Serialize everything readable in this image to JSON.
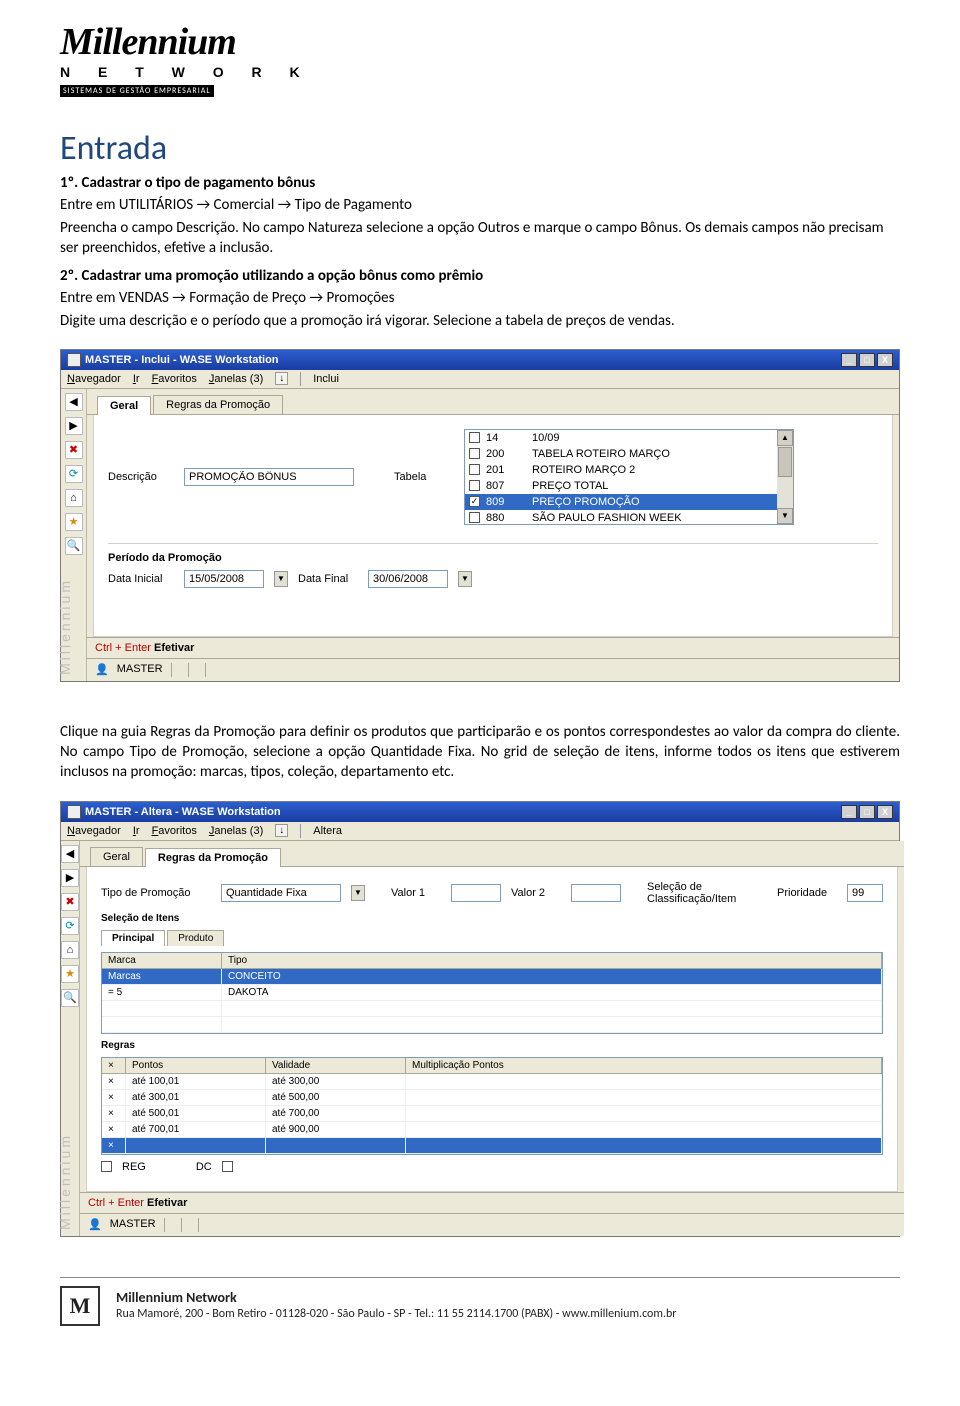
{
  "logo": {
    "brand": "Millennium",
    "network": "N E T W O R K",
    "tag": "SISTEMAS DE GESTÃO EMPRESARIAL"
  },
  "doc": {
    "title": "Entrada",
    "step1_head": "1º. Cadastrar o tipo de pagamento bônus",
    "step1_l1": "Entre em UTILITÁRIOS → Comercial → Tipo de Pagamento",
    "step1_l2": "Preencha o campo Descrição. No campo Natureza selecione a opção Outros e marque o campo Bônus. Os demais campos não precisam ser preenchidos, efetive a inclusão.",
    "step2_head": "2º. Cadastrar uma promoção utilizando a opção bônus como prêmio",
    "step2_l1": "Entre em VENDAS → Formação de Preço → Promoções",
    "step2_l2": "Digite uma descrição e o período que a promoção irá vigorar. Selecione a tabela de preços de vendas.",
    "after_p1": "Clique na guia Regras da Promoção para definir os produtos que participarão e os pontos correspondestes ao valor da compra do cliente. No campo Tipo de Promoção, selecione a opção Quantidade Fixa. No grid de seleção de itens, informe todos os itens que estiverem inclusos na promoção: marcas, tipos, coleção, departamento etc."
  },
  "win1": {
    "title": "MASTER - Inclui - WASE Workstation",
    "menu": {
      "nav": "Navegador",
      "ir": "Ir",
      "fav": "Favoritos",
      "jan": "Janelas (3)",
      "crumb": "Inclui"
    },
    "tabs": {
      "geral": "Geral",
      "regras": "Regras da Promoção"
    },
    "labels": {
      "descricao": "Descrição",
      "tabela": "Tabela",
      "periodo": "Período da Promoção",
      "data_inicial": "Data Inicial",
      "data_final": "Data Final"
    },
    "values": {
      "descricao": "PROMOÇÃO BÔNUS",
      "data_inicial": "15/05/2008",
      "data_final": "30/06/2008"
    },
    "tabela_rows": [
      {
        "checked": false,
        "code": "14",
        "desc": "10/09"
      },
      {
        "checked": false,
        "code": "200",
        "desc": "TABELA ROTEIRO MARÇO"
      },
      {
        "checked": false,
        "code": "201",
        "desc": "ROTEIRO MARÇO 2"
      },
      {
        "checked": false,
        "code": "807",
        "desc": "PREÇO TOTAL"
      },
      {
        "checked": true,
        "code": "809",
        "desc": "PREÇO PROMOÇÃO"
      },
      {
        "checked": false,
        "code": "880",
        "desc": "SÃO PAULO FASHION WEEK"
      }
    ],
    "status": {
      "efetivar": "Ctrl + Enter Efetivar",
      "user": "MASTER"
    }
  },
  "win2": {
    "title": "MASTER - Altera - WASE Workstation",
    "menu": {
      "nav": "Navegador",
      "ir": "Ir",
      "fav": "Favoritos",
      "jan": "Janelas (3)",
      "crumb": "Altera"
    },
    "tabs": {
      "geral": "Geral",
      "regras": "Regras da Promoção"
    },
    "labels": {
      "tipo": "Tipo de Promoção",
      "tipo_val": "Quantidade Fixa",
      "valor1": "Valor 1",
      "valor2": "Valor 2",
      "sel0": "Seleção de Classificação/Item",
      "prioridade": "Prioridade",
      "prioridade_val": "99",
      "selitens": "Seleção de Itens",
      "subtab1": "Principal",
      "subtab2": "Produto",
      "col_marca": "Marca",
      "col_tipo": "Tipo",
      "regras_head": "Regras",
      "regra_col1": "Pontos",
      "regra_col2": "Validade",
      "regra_col3": "Multiplicação Pontos",
      "check_label": "DC",
      "regbox": "REG"
    },
    "marca_rows": [
      {
        "c1": "Marcas",
        "c2": "CONCEITO"
      },
      {
        "c1": "= 5",
        "c2": "DAKOTA"
      }
    ],
    "regras_rows": [
      {
        "c1": "até 100,01",
        "c2": "até 300,00"
      },
      {
        "c1": "até 300,01",
        "c2": "até 500,00"
      },
      {
        "c1": "até 500,01",
        "c2": "até 700,00"
      },
      {
        "c1": "até 700,01",
        "c2": "até 900,00"
      }
    ],
    "status": {
      "efetivar": "Ctrl + Enter Efetivar",
      "user": "MASTER"
    }
  },
  "footer": {
    "brand": "Millennium Network",
    "addr": "Rua Mamoré, 200 - Bom Retiro - 01128-020 - São Paulo - SP - Tel.: 11 55 2114.1700 (PABX) - www.millenium.com.br"
  },
  "vtext": "Millennium"
}
